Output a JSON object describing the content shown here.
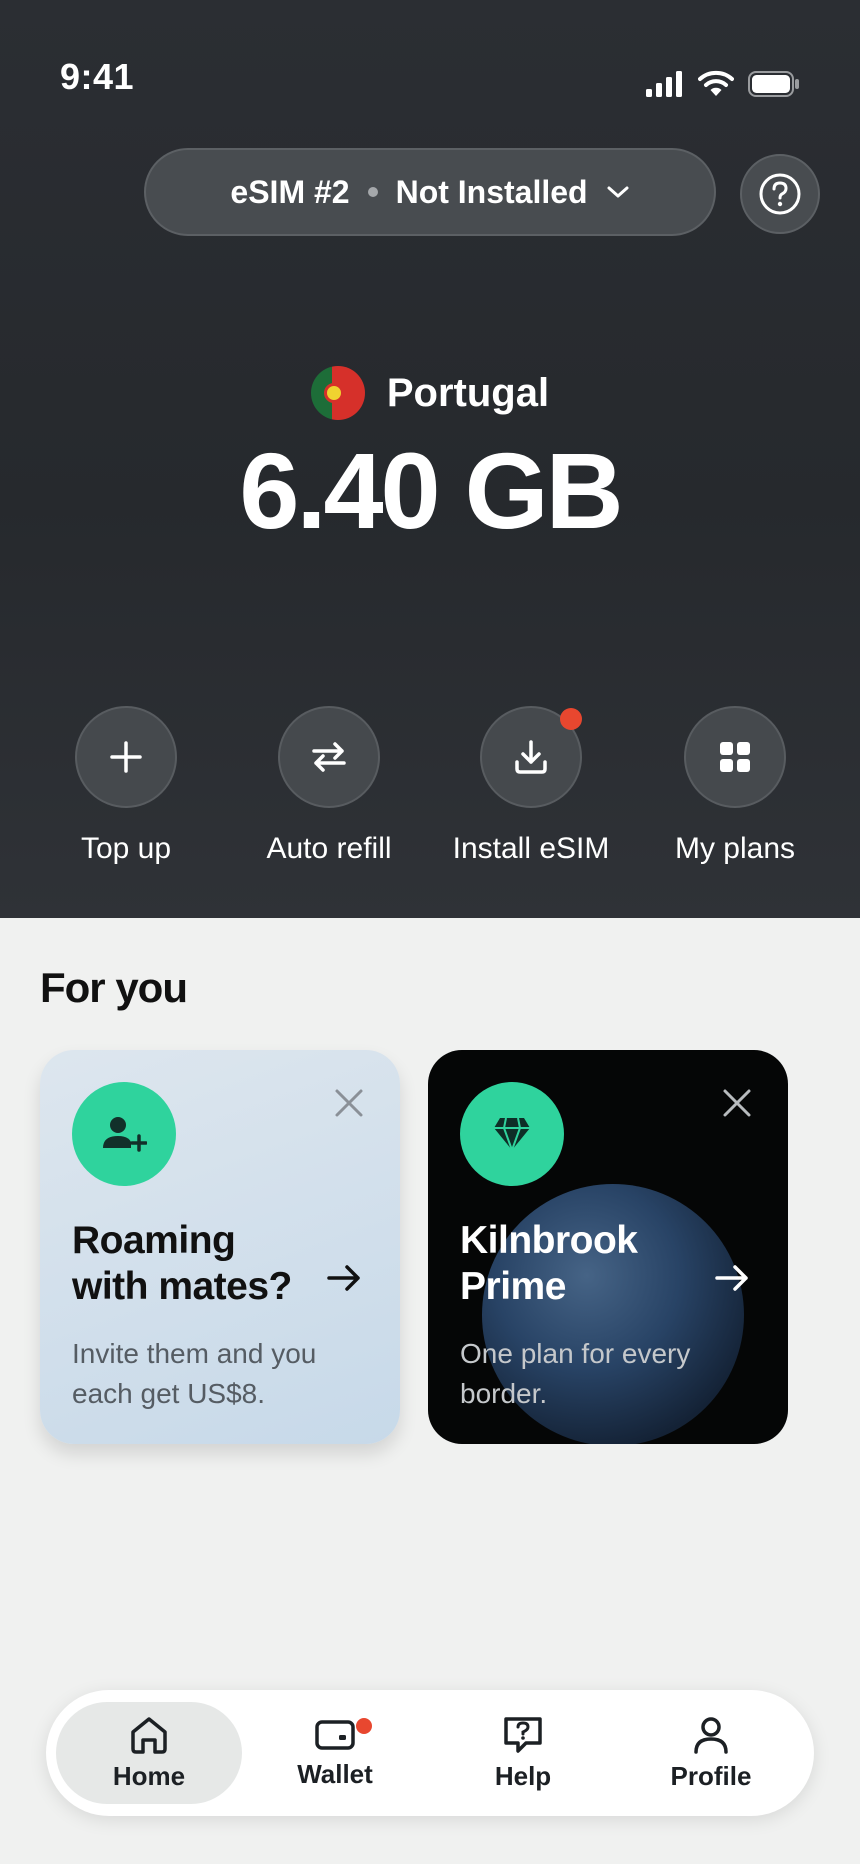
{
  "status_bar": {
    "time": "9:41"
  },
  "esim_selector": {
    "name": "eSIM #2",
    "status": "Not Installed"
  },
  "plan": {
    "country": "Portugal",
    "data_remaining": "6.40 GB"
  },
  "actions": [
    {
      "label": "Top up",
      "icon": "plus-icon"
    },
    {
      "label": "Auto refill",
      "icon": "swap-arrows-icon"
    },
    {
      "label": "Install eSIM",
      "icon": "download-icon",
      "badge": true
    },
    {
      "label": "My plans",
      "icon": "grid-icon"
    }
  ],
  "for_you": {
    "title": "For you",
    "cards": [
      {
        "title": "Roaming with mates?",
        "description": "Invite them and you each get US$8.",
        "icon": "add-user-icon"
      },
      {
        "title": "Kilnbrook Prime",
        "description": "One plan for every border.",
        "icon": "diamond-icon"
      }
    ]
  },
  "nav": {
    "items": [
      {
        "label": "Home",
        "icon": "home-icon",
        "active": true
      },
      {
        "label": "Wallet",
        "icon": "wallet-icon",
        "badge": true
      },
      {
        "label": "Help",
        "icon": "help-chat-icon"
      },
      {
        "label": "Profile",
        "icon": "profile-icon"
      }
    ]
  },
  "colors": {
    "accent": "#2fd39d",
    "badge": "#e8472f",
    "hero_bg": "#2b2e33"
  }
}
